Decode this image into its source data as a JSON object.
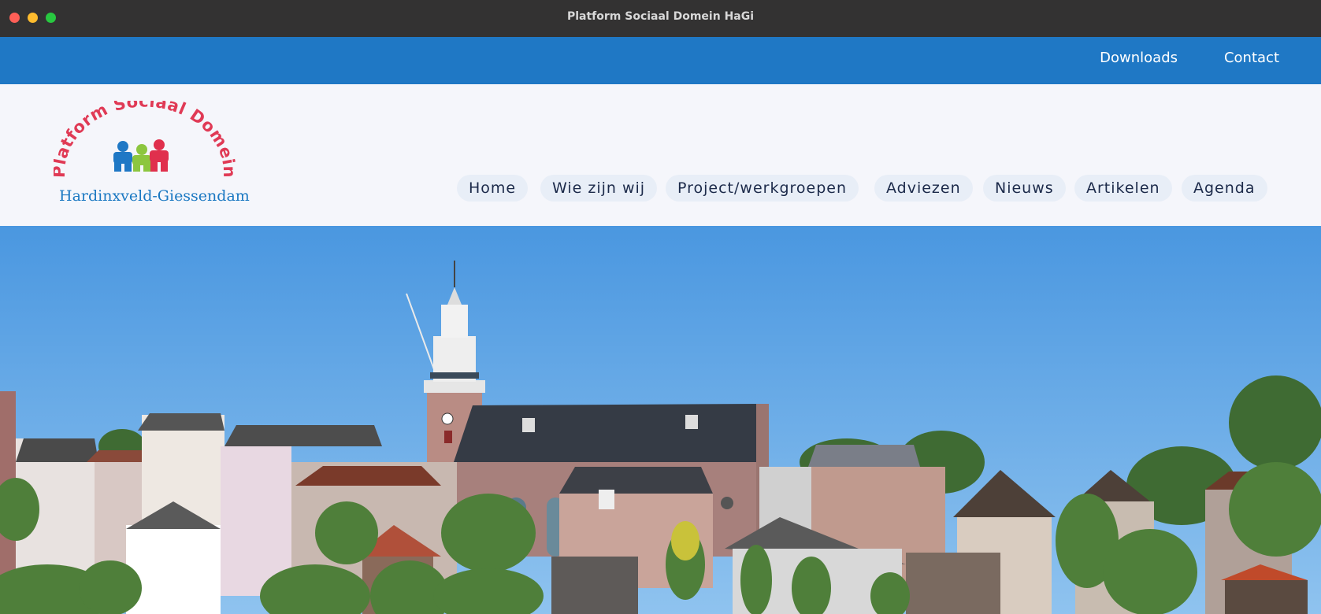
{
  "window": {
    "title": "Platform Sociaal Domein HaGi"
  },
  "topbar": {
    "links": [
      {
        "label": "Downloads"
      },
      {
        "label": "Contact"
      }
    ]
  },
  "logo": {
    "arc_text": "Platform Sociaal Domein",
    "subtitle": "Hardinxveld-Giessendam",
    "colors": {
      "arc": "#e03a55",
      "figure_blue": "#1f78c5",
      "figure_green": "#8cc63f",
      "figure_red": "#e0304d"
    }
  },
  "nav": {
    "items": [
      {
        "label": "Home"
      },
      {
        "label": "Wie zijn wij"
      },
      {
        "label": "Project/werkgroepen"
      },
      {
        "label": "Adviezen"
      },
      {
        "label": "Nieuws"
      },
      {
        "label": "Artikelen"
      },
      {
        "label": "Agenda"
      }
    ]
  },
  "colors": {
    "accent": "#1f78c5",
    "header_bg": "#f5f6fb",
    "nav_pill": "#e8eef7",
    "nav_text": "#1c2a4a"
  }
}
